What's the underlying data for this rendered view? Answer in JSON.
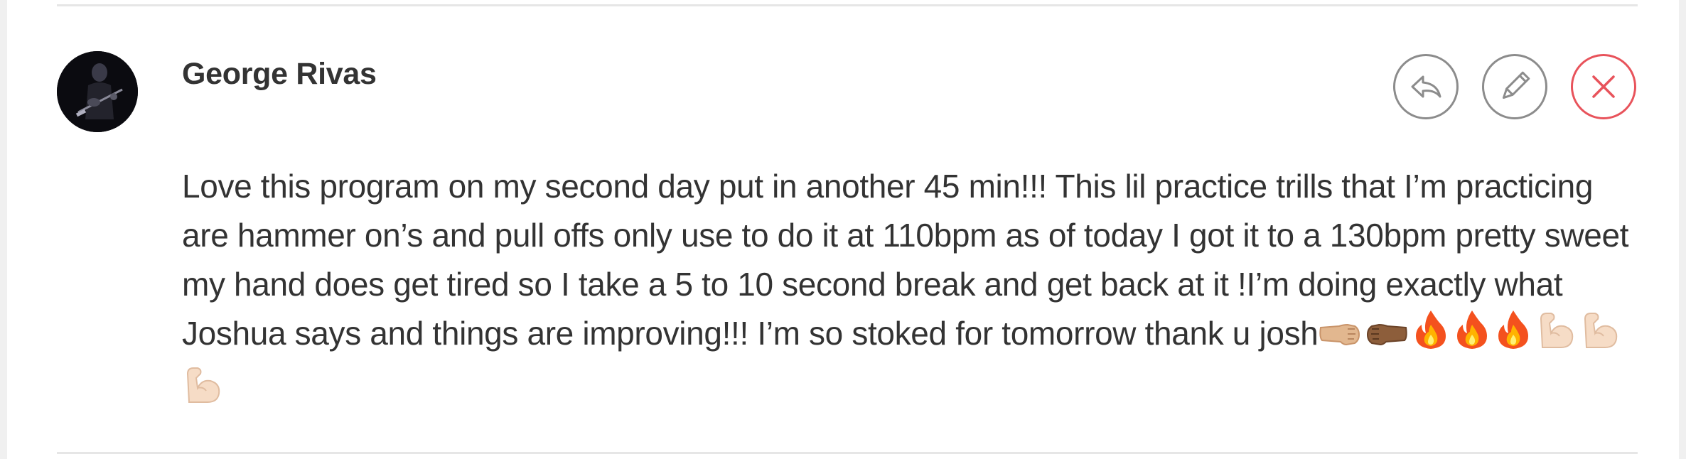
{
  "comment": {
    "author": "George Rivas",
    "body": "Love this program on my second day put in another 45 min!!! This lil practice trills that I’m practicing are hammer on’s and pull offs only use to do it at 110bpm as of today I got it to a 130bpm pretty sweet my hand does get tired so I take a 5 to 10 second break and get back at it !I’m doing exactly what Joshua says and things are improving!!! I’m so stoked for tomorrow thank u josh",
    "emojis": [
      "fist-bump-right-light",
      "fist-bump-left-dark",
      "fire",
      "fire",
      "fire",
      "flexed-biceps",
      "flexed-biceps",
      "flexed-biceps"
    ]
  },
  "actions": {
    "reply_icon": "reply-arrow-icon",
    "edit_icon": "pencil-icon",
    "delete_icon": "close-x-icon"
  },
  "colors": {
    "text": "#333333",
    "button_border": "#8c8c8c",
    "delete_accent": "#e8535b",
    "divider": "#e6e6e6"
  }
}
